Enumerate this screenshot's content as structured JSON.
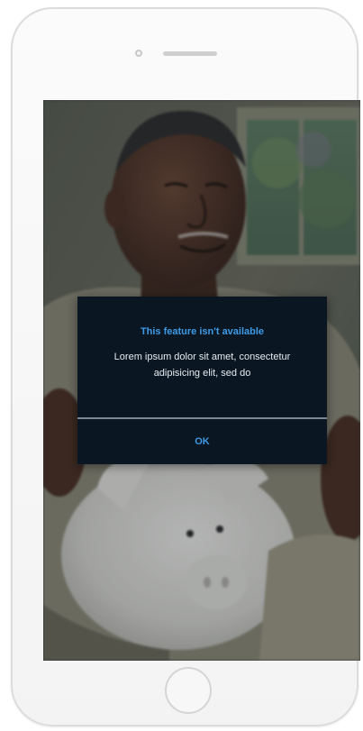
{
  "background": {
    "description_icon": "man-with-piggy-bank-photo"
  },
  "dialog": {
    "title": "This feature isn't available",
    "message": "Lorem ipsum dolor sit amet, consectetur adipisicing elit, sed do",
    "ok_label": "OK"
  },
  "colors": {
    "dialog_background": "#0a1722",
    "accent": "#3f9ae6",
    "message_text": "#e6ecf1",
    "divider": "#7d8891"
  }
}
